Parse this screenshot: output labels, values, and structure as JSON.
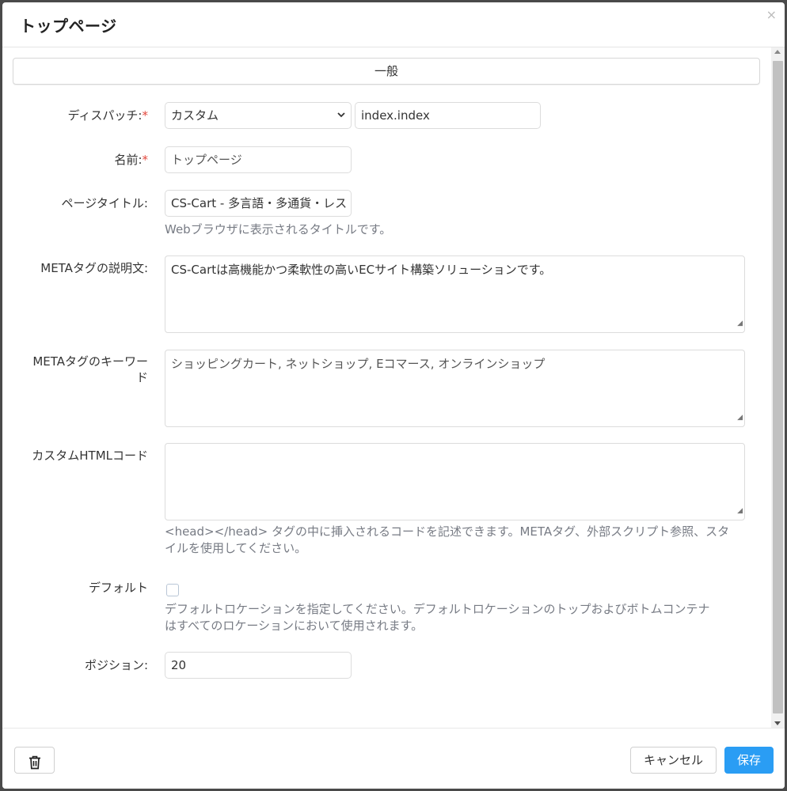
{
  "dialog": {
    "title": "トップページ",
    "close_glyph": "×"
  },
  "section": {
    "label": "一般"
  },
  "fields": {
    "dispatch": {
      "label": "ディスパッチ:",
      "required_mark": "*",
      "select_value": "カスタム",
      "value": "index.index"
    },
    "name": {
      "label": "名前:",
      "required_mark": "*",
      "value": "トップページ"
    },
    "page_title": {
      "label": "ページタイトル:",
      "value": "CS-Cart - 多言語・多通貨・レス",
      "hint": "Webブラウザに表示されるタイトルです。"
    },
    "meta_description": {
      "label": "METAタグの説明文:",
      "value": "CS-Cartは高機能かつ柔軟性の高いECサイト構築ソリューションです。"
    },
    "meta_keywords": {
      "label_line1": "METAタグのキーワー",
      "label_line2": "ド",
      "value": "ショッピングカート, ネットショップ, Eコマース, オンラインショップ"
    },
    "custom_html": {
      "label": "カスタムHTMLコード",
      "value": "",
      "hint_line1": "<head></head> タグの中に挿入されるコードを記述できます。METAタグ、外部スクリプト参照、スタ",
      "hint_line2": "イルを使用してください。"
    },
    "default": {
      "label": "デフォルト",
      "checked": false,
      "hint_line1": "デフォルトロケーションを指定してください。デフォルトロケーションのトップおよびボトムコンテナ",
      "hint_line2": "はすべてのロケーションにおいて使用されます。"
    },
    "position": {
      "label": "ポジション:",
      "value": "20"
    }
  },
  "footer": {
    "delete_icon": "trash-icon",
    "cancel_label": "キャンセル",
    "save_label": "保存"
  },
  "colors": {
    "primary": "#2a9df4",
    "required": "#e3483d",
    "hint": "#777b84"
  }
}
